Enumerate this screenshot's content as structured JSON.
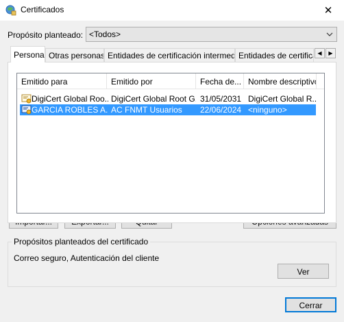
{
  "window": {
    "title": "Certificados",
    "close_glyph": "✕"
  },
  "purpose": {
    "label": "Propósito planteado:",
    "value": "<Todos>"
  },
  "tabs": [
    {
      "label": "Personal"
    },
    {
      "label": "Otras personas"
    },
    {
      "label": "Entidades de certificación intermedias"
    },
    {
      "label": "Entidades de certificaci"
    }
  ],
  "table": {
    "columns": [
      "Emitido para",
      "Emitido por",
      "Fecha de...",
      "Nombre descriptivo"
    ],
    "rows": [
      {
        "issued_to": "DigiCert Global Roo...",
        "issued_by": "DigiCert Global Root G...",
        "date": "31/05/2031",
        "friendly": "DigiCert Global R..."
      },
      {
        "issued_to": "GARCIA ROBLES A...",
        "issued_by": "AC FNMT Usuarios",
        "date": "22/06/2024",
        "friendly": "<ninguno>"
      }
    ],
    "selected_row": 1
  },
  "buttons": {
    "import": "Importar...",
    "export": "Exportar...",
    "remove": "Quitar",
    "advanced": "Opciones avanzadas",
    "view": "Ver",
    "close": "Cerrar"
  },
  "purposes_group": {
    "title": "Propósitos planteados del certificado",
    "text": "Correo seguro, Autenticación del cliente"
  },
  "colors": {
    "selection": "#3399ff",
    "default_button_border": "#0078d7"
  }
}
